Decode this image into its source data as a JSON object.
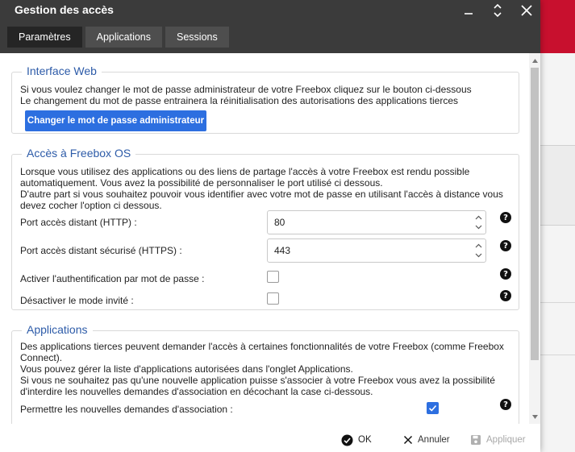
{
  "window": {
    "title": "Gestion des accès"
  },
  "tabs": [
    {
      "label": "Paramètres",
      "active": true
    },
    {
      "label": "Applications",
      "active": false
    },
    {
      "label": "Sessions",
      "active": false
    }
  ],
  "interface_web": {
    "legend": "Interface Web",
    "lines": [
      "Si vous voulez changer le mot de passe administrateur de votre Freebox cliquez sur le bouton ci-dessous",
      "Le changement du mot de passe entrainera la réinitialisation des autorisations des applications tierces"
    ],
    "button_label": "Changer le mot de passe administrateur"
  },
  "acces_freebox": {
    "legend": "Accès à Freebox OS",
    "lines": [
      "Lorsque vous utilisez des applications ou des liens de partage l'accès à votre Freebox est rendu possible",
      "automatiquement. Vous avez la possibilité de personnaliser le port utilisé ci dessous.",
      "D'autre part si vous souhaitez pouvoir vous identifier avec votre mot de passe en utilisant l'accès à distance vous",
      "devez cocher l'option ci dessous."
    ],
    "http_port": {
      "label": "Port accès distant (HTTP) :",
      "value": "80"
    },
    "https_port": {
      "label": "Port accès distant sécurisé (HTTPS) :",
      "value": "443"
    },
    "password_auth": {
      "label": "Activer l'authentification par mot de passe :",
      "checked": false
    },
    "guest_mode": {
      "label": "Désactiver le mode invité :",
      "checked": false
    }
  },
  "applications": {
    "legend": "Applications",
    "lines": [
      "Des applications tierces peuvent demander l'accès à certaines fonctionnalités de votre Freebox (comme Freebox",
      "Connect).",
      "Vous pouvez gérer la liste d'applications autorisées dans l'onglet Applications.",
      "Si vous ne souhaitez pas qu'une nouvelle application puisse s'associer à votre Freebox vous avez la possibilité",
      "d'interdire les nouvelles demandes d'association en décochant la case ci-dessous."
    ],
    "allow_new": {
      "label": "Permettre les nouvelles demandes d'association :",
      "checked": true
    }
  },
  "help_glyph": "?",
  "footer": {
    "ok_label": "OK",
    "cancel_label": "Annuler",
    "apply_label": "Appliquer"
  },
  "colors": {
    "accent": "#2d6fe0",
    "legend": "#2d5ba8",
    "titlebar": "#3b3b3b",
    "brand_red": "#c8102e"
  }
}
